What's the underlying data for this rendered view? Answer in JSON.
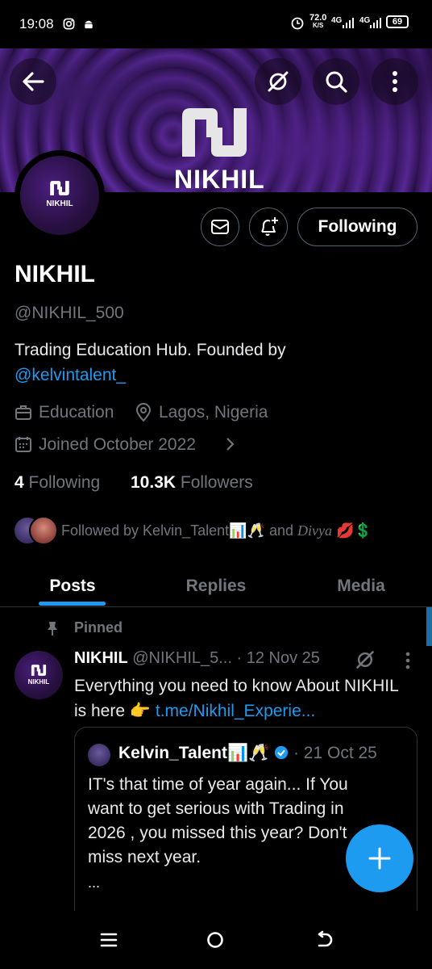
{
  "status_bar": {
    "time": "19:08",
    "speed": "72.0",
    "speed_unit": "K/S",
    "net1": "4G",
    "net2": "4G",
    "battery": "69"
  },
  "profile": {
    "banner_logo_text": "NIKHIL",
    "avatar_logo_text": "NIKHIL",
    "display_name": "NIKHIL",
    "handle": "@NIKHIL_500",
    "bio_text": "Trading Education Hub.  Founded by",
    "bio_link": "@kelvintalent_",
    "category": "Education",
    "location": "Lagos, Nigeria",
    "joined": "Joined October 2022",
    "following_count": "4",
    "following_label": "Following",
    "followers_count": "10.3K",
    "followers_label": "Followers",
    "followed_by_text": "Followed by Kelvin_Talent📊🥂 and",
    "followed_by_name2": "Divya",
    "followed_by_emojis": "💋💲"
  },
  "actions": {
    "following_button": "Following"
  },
  "tabs": [
    "Posts",
    "Replies",
    "Media"
  ],
  "post": {
    "pinned_label": "Pinned",
    "author_name": "NIKHIL",
    "author_handle": "@NIKHIL_5...",
    "date": "· 12 Nov 25",
    "avatar_text": "NIKHIL",
    "text": "Everything you need to know About NIKHIL is here 👉",
    "link": "t.me/Nikhil_Experie..."
  },
  "quote": {
    "author": "Kelvin_Talent📊🥂",
    "date": "· 21 Oct 25",
    "text": "IT's that time of year again... If You want to get serious with Trading in 2026 , you missed this year? Don't miss next year.",
    "ellipsis": "..."
  },
  "colors": {
    "accent": "#1d9bf0",
    "muted": "#71767b",
    "border": "#2f3336",
    "background": "#000000"
  }
}
